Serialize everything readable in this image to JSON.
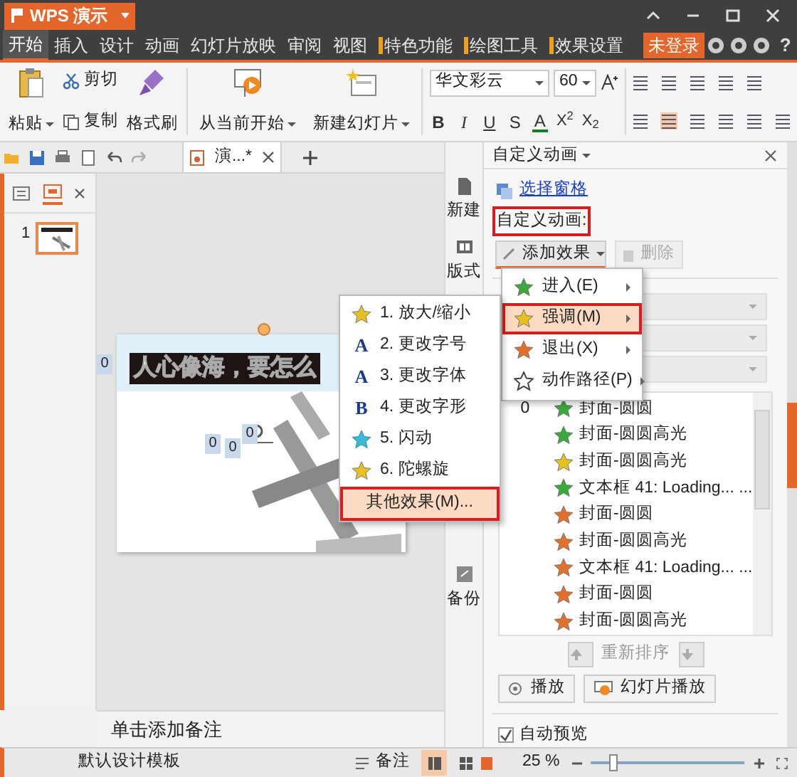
{
  "app_button": {
    "label": "WPS 演示"
  },
  "menu_tabs": [
    {
      "label": "开始",
      "selected": true,
      "kind": "normal"
    },
    {
      "label": "插入",
      "selected": false,
      "kind": "normal"
    },
    {
      "label": "设计",
      "selected": false,
      "kind": "normal"
    },
    {
      "label": "动画",
      "selected": false,
      "kind": "normal"
    },
    {
      "label": "幻灯片放映",
      "selected": false,
      "kind": "normal"
    },
    {
      "label": "审阅",
      "selected": false,
      "kind": "normal"
    },
    {
      "label": "视图",
      "selected": false,
      "kind": "normal"
    },
    {
      "label": "特色功能",
      "selected": false,
      "kind": "contextual"
    },
    {
      "label": "绘图工具",
      "selected": false,
      "kind": "contextual"
    },
    {
      "label": "效果设置",
      "selected": false,
      "kind": "contextual"
    }
  ],
  "login_button": {
    "label": "未登录"
  },
  "help_button": {
    "label": "?"
  },
  "ribbon": {
    "paste": "粘贴",
    "cut": "剪切",
    "copy": "复制",
    "format_painter": "格式刷",
    "from_current": "从当前开始",
    "new_slide": "新建幻灯片",
    "font_name": "华文彩云",
    "font_size": "60",
    "bold": "B",
    "italic": "I",
    "underline": "U",
    "shadow": "S",
    "font_color": "A",
    "superscript": "X$^{2}$",
    "subscript": "X$_{2}$"
  },
  "doc_tab": {
    "title": "演...*"
  },
  "slides": [
    {
      "number": "1",
      "selected": true
    }
  ],
  "slide": {
    "title": "人心像海，要怎么",
    "tags": [
      "0",
      "0",
      "0",
      "0"
    ]
  },
  "notes": {
    "placeholder": "单击添加备注"
  },
  "side_toolbar": [
    {
      "label": "新建",
      "kind": "new"
    },
    {
      "label": "版式",
      "kind": "layout"
    },
    {
      "label": "备份",
      "kind": "backup"
    }
  ],
  "task_pane": {
    "title": "自定义动画",
    "select_pane": "选择窗格",
    "section_label": {
      "text": "自定义动画:",
      "annotated": true
    },
    "add_effect": "添加效果",
    "delete": {
      "label": "删除",
      "disabled": true
    },
    "effects": [
      {
        "order": "0",
        "name": "封面-圆圆",
        "kind": "entrance"
      },
      {
        "name": "封面-圆圆高光",
        "kind": "entrance"
      },
      {
        "name": "封面-圆圆高光",
        "kind": "emphasis"
      },
      {
        "name": "文本框 41: Loading... ...",
        "kind": "entrance"
      },
      {
        "name": "封面-圆圆",
        "kind": "exit"
      },
      {
        "name": "封面-圆圆高光",
        "kind": "exit"
      },
      {
        "name": "文本框 41: Loading... ...",
        "kind": "exit"
      },
      {
        "name": "封面-圆圆",
        "kind": "exit"
      },
      {
        "name": "封面-圆圆高光",
        "kind": "exit"
      }
    ],
    "reorder": "重新排序",
    "play": "播放",
    "slideshow": "幻灯片播放",
    "auto_preview": {
      "label": "自动预览",
      "checked": true
    }
  },
  "add_effect_menu": [
    {
      "label": "进入(E)",
      "kind": "entrance",
      "selected": false
    },
    {
      "label": "强调(M)",
      "kind": "emphasis",
      "selected": true
    },
    {
      "label": "退出(X)",
      "kind": "exit",
      "selected": false
    },
    {
      "label": "动作路径(P)",
      "kind": "path",
      "selected": false
    }
  ],
  "emphasis_menu": {
    "items": [
      {
        "label": "1. 放大/缩小",
        "kind": "star"
      },
      {
        "label": "2. 更改字号",
        "kind": "glyph",
        "glyph": "A"
      },
      {
        "label": "3. 更改字体",
        "kind": "glyph",
        "glyph": "A"
      },
      {
        "label": "4. 更改字形",
        "kind": "glyph",
        "glyph": "B"
      },
      {
        "label": "5. 闪动",
        "kind": "blink"
      },
      {
        "label": "6. 陀螺旋",
        "kind": "star"
      }
    ],
    "more": {
      "label": "其他效果(M)...",
      "selected": true
    }
  },
  "status_bar": {
    "template": "默认设计模板",
    "notes": "备注",
    "zoom": "25 %",
    "zoom_slider": {
      "level": 0.12
    }
  }
}
